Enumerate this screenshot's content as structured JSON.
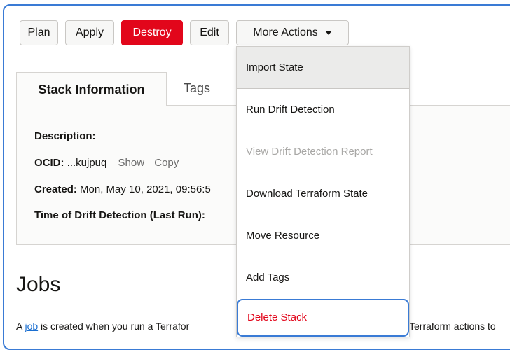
{
  "toolbar": {
    "plan": "Plan",
    "apply": "Apply",
    "destroy": "Destroy",
    "edit": "Edit",
    "more_actions": "More Actions",
    "destroy_color": "#e2061b"
  },
  "tabs": [
    "Stack Information",
    "Tags"
  ],
  "stack_info": {
    "description_label": "Description:",
    "ocid_label": "OCID:",
    "ocid_value": " ...kujpuq",
    "show_link": "Show",
    "copy_link": "Copy",
    "created_label": "Created:",
    "created_value": " Mon, May 10, 2021, 09:56:5",
    "drift_label": "Time of Drift Detection (Last Run):"
  },
  "jobs": {
    "title": "Jobs",
    "text_a": "A ",
    "text_link": "job",
    "text_b": " is created when you run a Terrafor",
    "text_right": "Terraform actions to"
  },
  "menu": {
    "items": [
      {
        "label": "Import State",
        "state": "hover"
      },
      {
        "label": "Run Drift Detection",
        "state": "normal"
      },
      {
        "label": "View Drift Detection Report",
        "state": "disabled"
      },
      {
        "label": "Download Terraform State",
        "state": "normal"
      },
      {
        "label": "Move Resource",
        "state": "normal"
      },
      {
        "label": "Add Tags",
        "state": "normal"
      },
      {
        "label": "Delete Stack",
        "state": "danger-focused"
      }
    ]
  }
}
